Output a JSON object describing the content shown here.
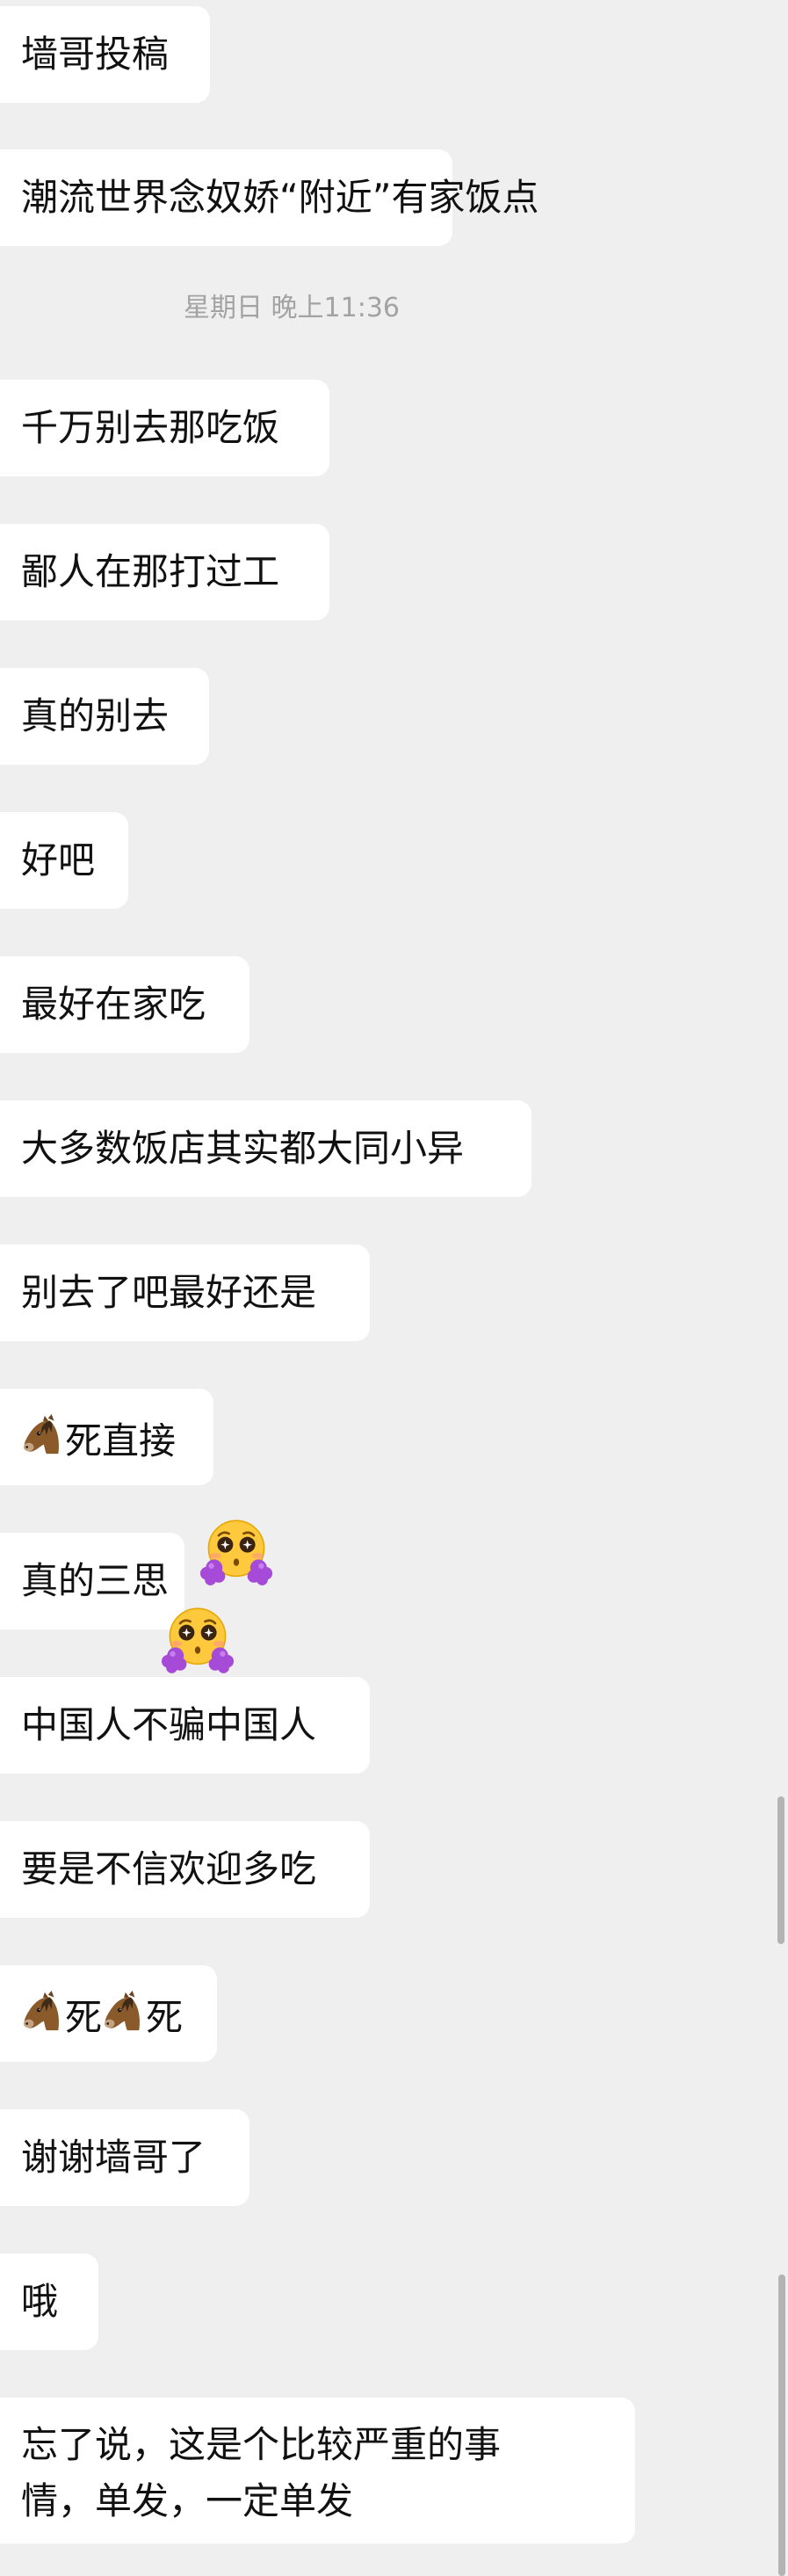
{
  "messages": [
    {
      "text": "墙哥投稿"
    },
    {
      "text": "潮流世界念奴娇“附近”有家饭点"
    },
    {
      "text": "千万别去那吃饭"
    },
    {
      "text": "鄙人在那打过工"
    },
    {
      "text": "真的别去"
    },
    {
      "text": "好吧"
    },
    {
      "text": "最好在家吃"
    },
    {
      "text": "大多数饭店其实都大同小异"
    },
    {
      "text": "别去了吧最好还是"
    },
    {
      "text": "死直接",
      "icon": "horse-face-icon"
    },
    {
      "text": "真的三思"
    },
    {
      "text": "中国人不骗中国人"
    },
    {
      "text": "要是不信欢迎多吃"
    },
    {
      "text": "死",
      "icon": "horse-face-icon"
    },
    {
      "text": "谢谢墙哥了"
    },
    {
      "text": "哦"
    },
    {
      "line1": "忘了说，这是个比较严重的事",
      "line2": "情，单发，一定单发"
    }
  ],
  "timestamp": "星期日 晚上11:36",
  "stickers": [
    "pleading-face-pompom-emoji",
    "pleading-face-pompom-emoji"
  ],
  "colors": {
    "background": "#efefef",
    "bubble": "#ffffff",
    "text": "#111111",
    "timestamp": "#a3a3a3",
    "scrollbar": "#b3b3b3"
  }
}
